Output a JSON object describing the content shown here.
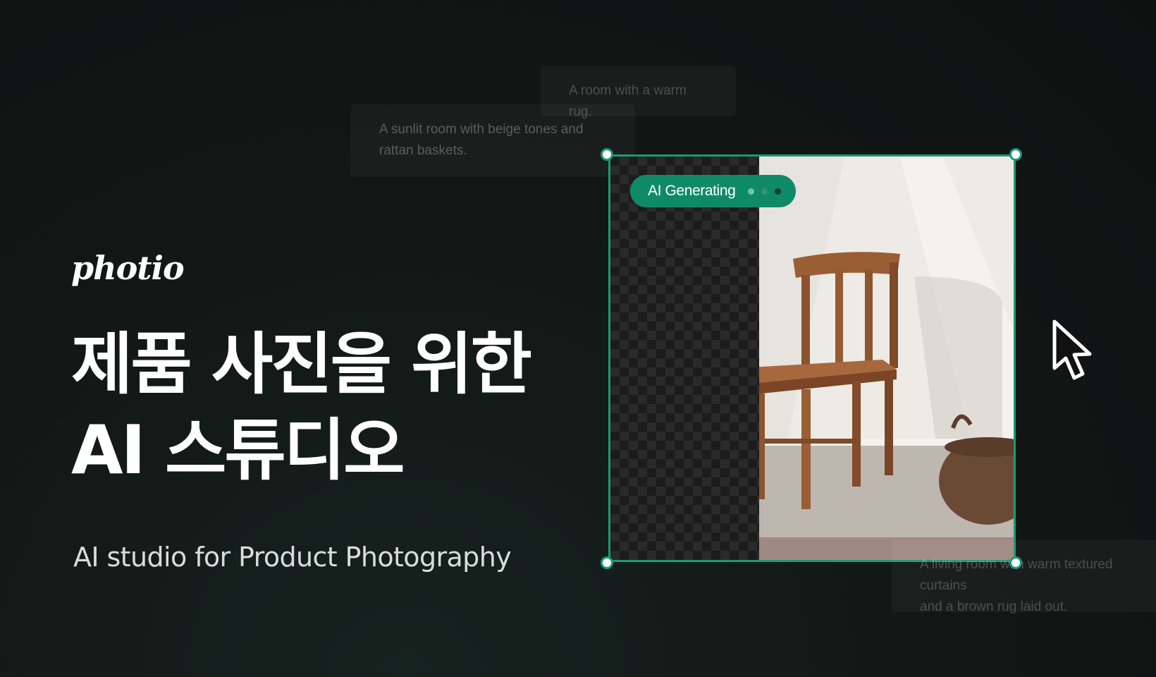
{
  "brand": {
    "logo_text": "photio"
  },
  "hero": {
    "headline_line1": "제품 사진을 위한",
    "headline_line2": "AI 스튜디오",
    "subtitle": "AI studio for Product Photography"
  },
  "prompts": {
    "rug": "A room with a warm rug.",
    "sunlit_line1": "A sunlit room with beige tones and",
    "sunlit_line2": "rattan baskets.",
    "living_line1": "A living room with warm textured curtains",
    "living_line2": "and a brown rug laid out."
  },
  "generator": {
    "status_label": "AI Generating",
    "subject": "wooden chair with basket"
  },
  "colors": {
    "accent": "#0f8a68",
    "frame": "#1a9a72",
    "background": "#121816"
  },
  "icons": {
    "cursor": "arrow-cursor-icon",
    "handle": "resize-handle-icon"
  }
}
